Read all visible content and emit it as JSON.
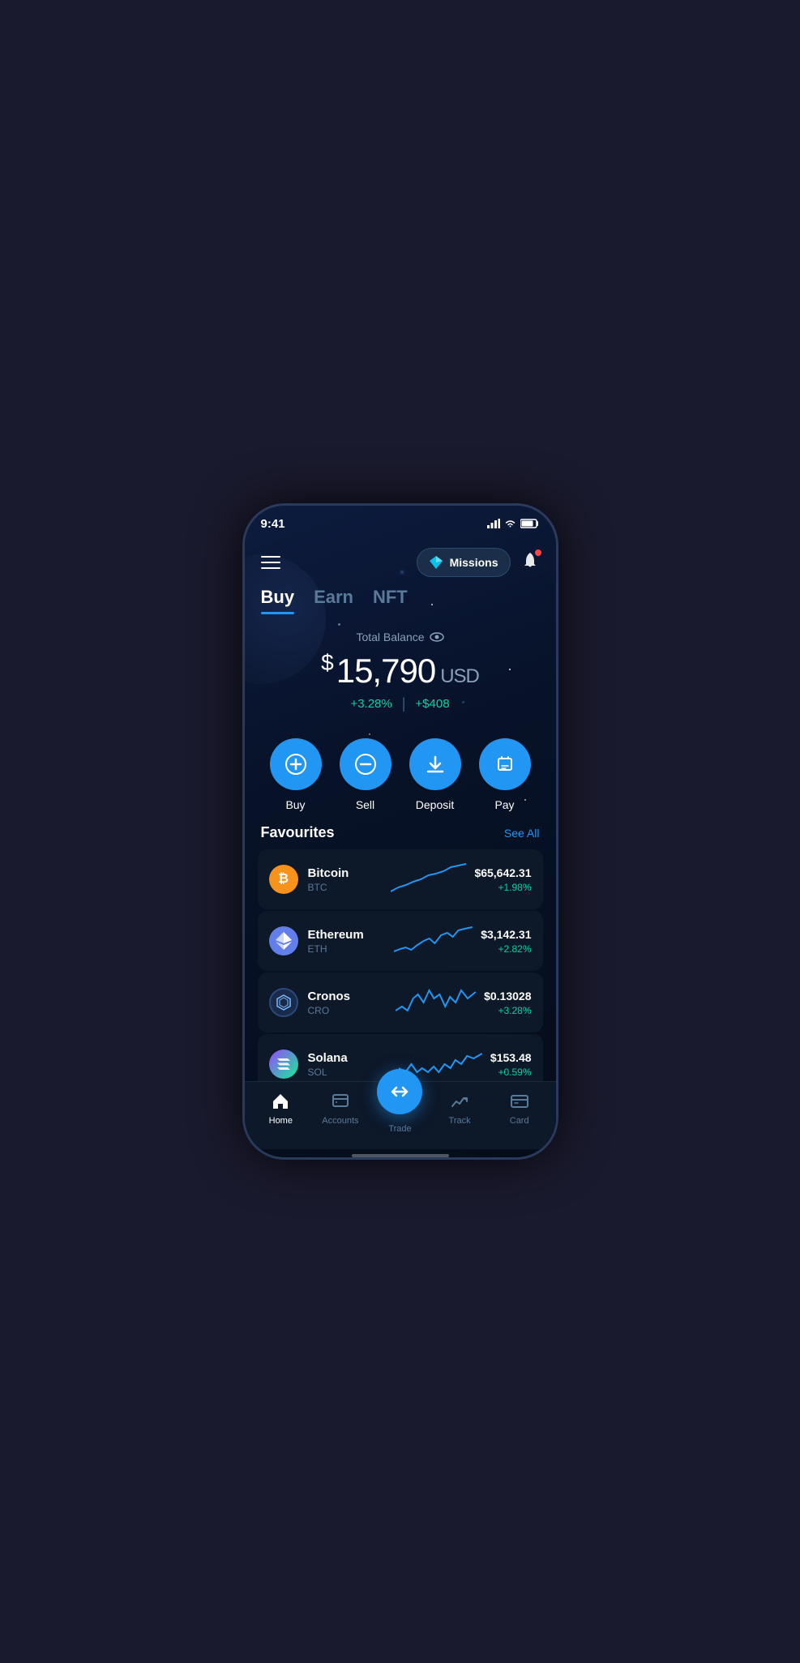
{
  "statusBar": {
    "time": "9:41"
  },
  "header": {
    "missionsLabel": "Missions"
  },
  "tabs": [
    {
      "id": "buy",
      "label": "Buy",
      "active": true
    },
    {
      "id": "earn",
      "label": "Earn",
      "active": false
    },
    {
      "id": "nft",
      "label": "NFT",
      "active": false
    }
  ],
  "balance": {
    "label": "Total Balance",
    "amount": "15,790",
    "currency": "USD",
    "changePercent": "+3.28%",
    "changeAmount": "+$408"
  },
  "actions": [
    {
      "id": "buy",
      "label": "Buy"
    },
    {
      "id": "sell",
      "label": "Sell"
    },
    {
      "id": "deposit",
      "label": "Deposit"
    },
    {
      "id": "pay",
      "label": "Pay"
    }
  ],
  "favourites": {
    "title": "Favourites",
    "seeAll": "See All",
    "items": [
      {
        "id": "btc",
        "name": "Bitcoin",
        "symbol": "BTC",
        "price": "$65,642.31",
        "change": "+1.98%"
      },
      {
        "id": "eth",
        "name": "Ethereum",
        "symbol": "ETH",
        "price": "$3,142.31",
        "change": "+2.82%"
      },
      {
        "id": "cro",
        "name": "Cronos",
        "symbol": "CRO",
        "price": "$0.13028",
        "change": "+3.28%"
      },
      {
        "id": "sol",
        "name": "Solana",
        "symbol": "SOL",
        "price": "$153.48",
        "change": "+0.59%"
      }
    ]
  },
  "bottomNav": [
    {
      "id": "home",
      "label": "Home",
      "active": true
    },
    {
      "id": "accounts",
      "label": "Accounts",
      "active": false
    },
    {
      "id": "trade",
      "label": "Trade",
      "active": false
    },
    {
      "id": "track",
      "label": "Track",
      "active": false
    },
    {
      "id": "card",
      "label": "Card",
      "active": false
    }
  ]
}
